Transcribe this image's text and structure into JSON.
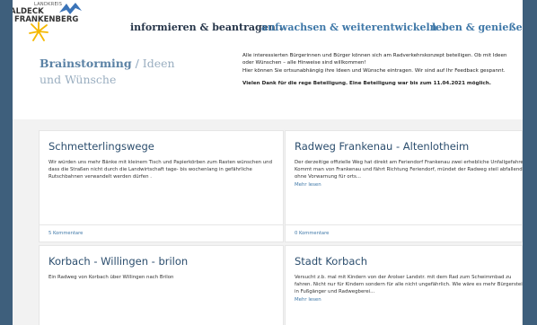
{
  "header": {
    "logo_small": "LANDKREIS",
    "logo_line1": "WALDECK",
    "logo_line2": "FRANKENBERG",
    "nav": [
      {
        "label": "informieren & beantragen"
      },
      {
        "label": "aufwachsen & weiterentwickeln"
      },
      {
        "label": "leben & genießen"
      }
    ],
    "chevron": "⌄"
  },
  "breadcrumb": {
    "current": "Brainstorming",
    "sep": " / ",
    "rest": "Ideen und Wünsche"
  },
  "intro": {
    "line1": "Alle interessierten Bürgerinnen und Bürger können sich am Radverkehrskonzept beteiligen. Ob mit Ideen oder Wünschen – alle Hinweise sind willkommen!",
    "line2": "Hier können Sie ortsunabhängig ihre Ideen und Wünsche eintragen. Wir sind auf Ihr Feedback gespannt.",
    "bold": "Vielen Dank für die rege Beteiligung. Eine Beteiligung war bis zum 11.04.2021 möglich."
  },
  "cards": [
    {
      "title": "Schmetterlingswege",
      "text": "Wir würden uns mehr Bänke mit kleinem Tisch und Papierkörben zum Rasten wünschen und dass die Straßen nicht durch die Landwirtschaft tage- bis wochenlang in gefährliche Rutschbahnen verwandelt werden dürfen .",
      "footer": "5 Kommentare"
    },
    {
      "title": "Radweg Frankenau - Altenlotheim",
      "text": "Der derzeitige offizielle Weg hat direkt am Feriendorf Frankenau zwei erhebliche Unfallgefahren. Kommt man von Frankenau und fährt Richtung Feriendorf, mündet der Radweg steil abfallend ohne Vorwarnung für orts...",
      "more": "Mehr lesen",
      "footer": "0 Kommentare"
    },
    {
      "title": "Korbach - Willingen - brilon",
      "text": "Ein Radweg von Korbach über Willingen nach Brilon"
    },
    {
      "title": "Stadt Korbach",
      "text": "Versucht z.b. mal mit Kindern von der Arolser Landstr. mit dem Rad zum Schwimmbad zu fahren. Nicht nur für Kindern sondern für alle nicht ungefährlich. Wie wäre es mehr Bürgersteige in Fußgänger und Radwegberei...",
      "more": "Mehr lesen"
    }
  ],
  "colors": {
    "frame": "#3e5f7c",
    "nav_dark": "#27364a",
    "nav_link": "#3f78a8",
    "card_title": "#2c4e6e",
    "logo_yellow": "#f5b800",
    "logo_blue": "#3b74b8"
  }
}
